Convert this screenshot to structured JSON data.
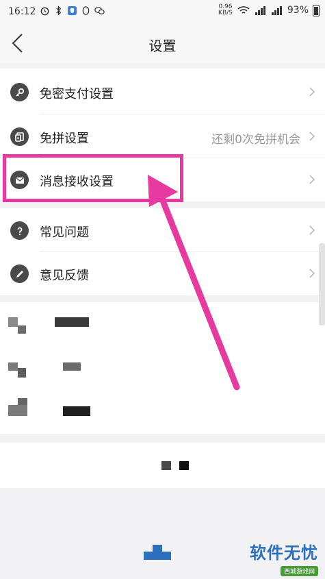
{
  "status_bar": {
    "time": "16:12",
    "net_speed_value": "0.96",
    "net_speed_unit": "KB/S",
    "battery": "93%"
  },
  "nav": {
    "title": "设置",
    "back_icon": "chevron-left-icon"
  },
  "groups": [
    {
      "items": [
        {
          "label": "免密支付设置",
          "icon": "key-icon",
          "value": ""
        },
        {
          "label": "免拼设置",
          "icon": "coupon-icon",
          "value": "还剩0次免拼机会"
        },
        {
          "label": "消息接收设置",
          "icon": "envelope-icon",
          "value": ""
        }
      ]
    },
    {
      "items": [
        {
          "label": "常见问题",
          "icon": "question-icon",
          "value": ""
        },
        {
          "label": "意见反馈",
          "icon": "pencil-icon",
          "value": ""
        }
      ]
    }
  ],
  "watermark": {
    "main": "软件无忧",
    "sub": "西城游戏网"
  },
  "colors": {
    "annotation": "#e63aa0",
    "brand_blue": "#2d6fbf"
  }
}
